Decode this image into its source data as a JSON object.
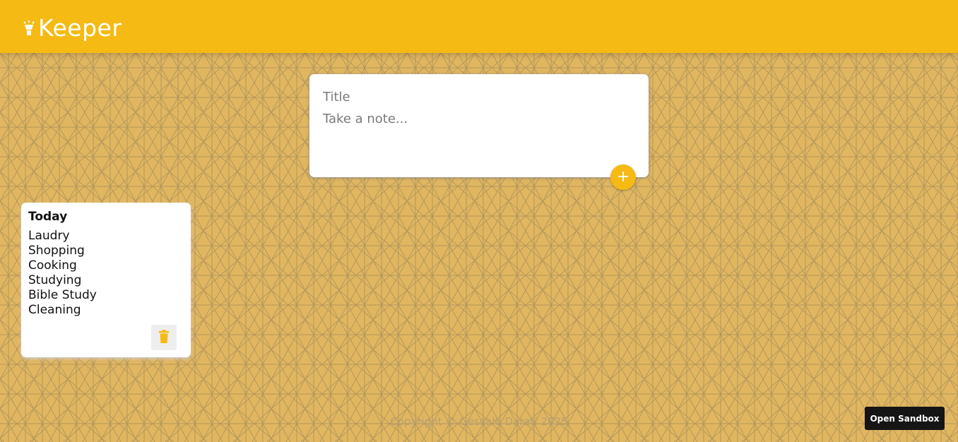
{
  "app": {
    "name": "Keeper",
    "brand_color": "#f5ba13",
    "logo_icon": "lightbulb-icon"
  },
  "create_note": {
    "title_placeholder": "Title",
    "content_placeholder": "Take a note...",
    "add_icon": "plus-icon"
  },
  "notes": [
    {
      "title": "Today",
      "lines": [
        "Laudry",
        "Shopping",
        "Cooking",
        "Studying",
        "Bible Study",
        "Cleaning"
      ],
      "delete_icon": "trash-icon"
    }
  ],
  "footer": {
    "copyright": "Copyright © Gescale Darati 2025"
  },
  "sandbox_button": {
    "label": "Open Sandbox"
  }
}
